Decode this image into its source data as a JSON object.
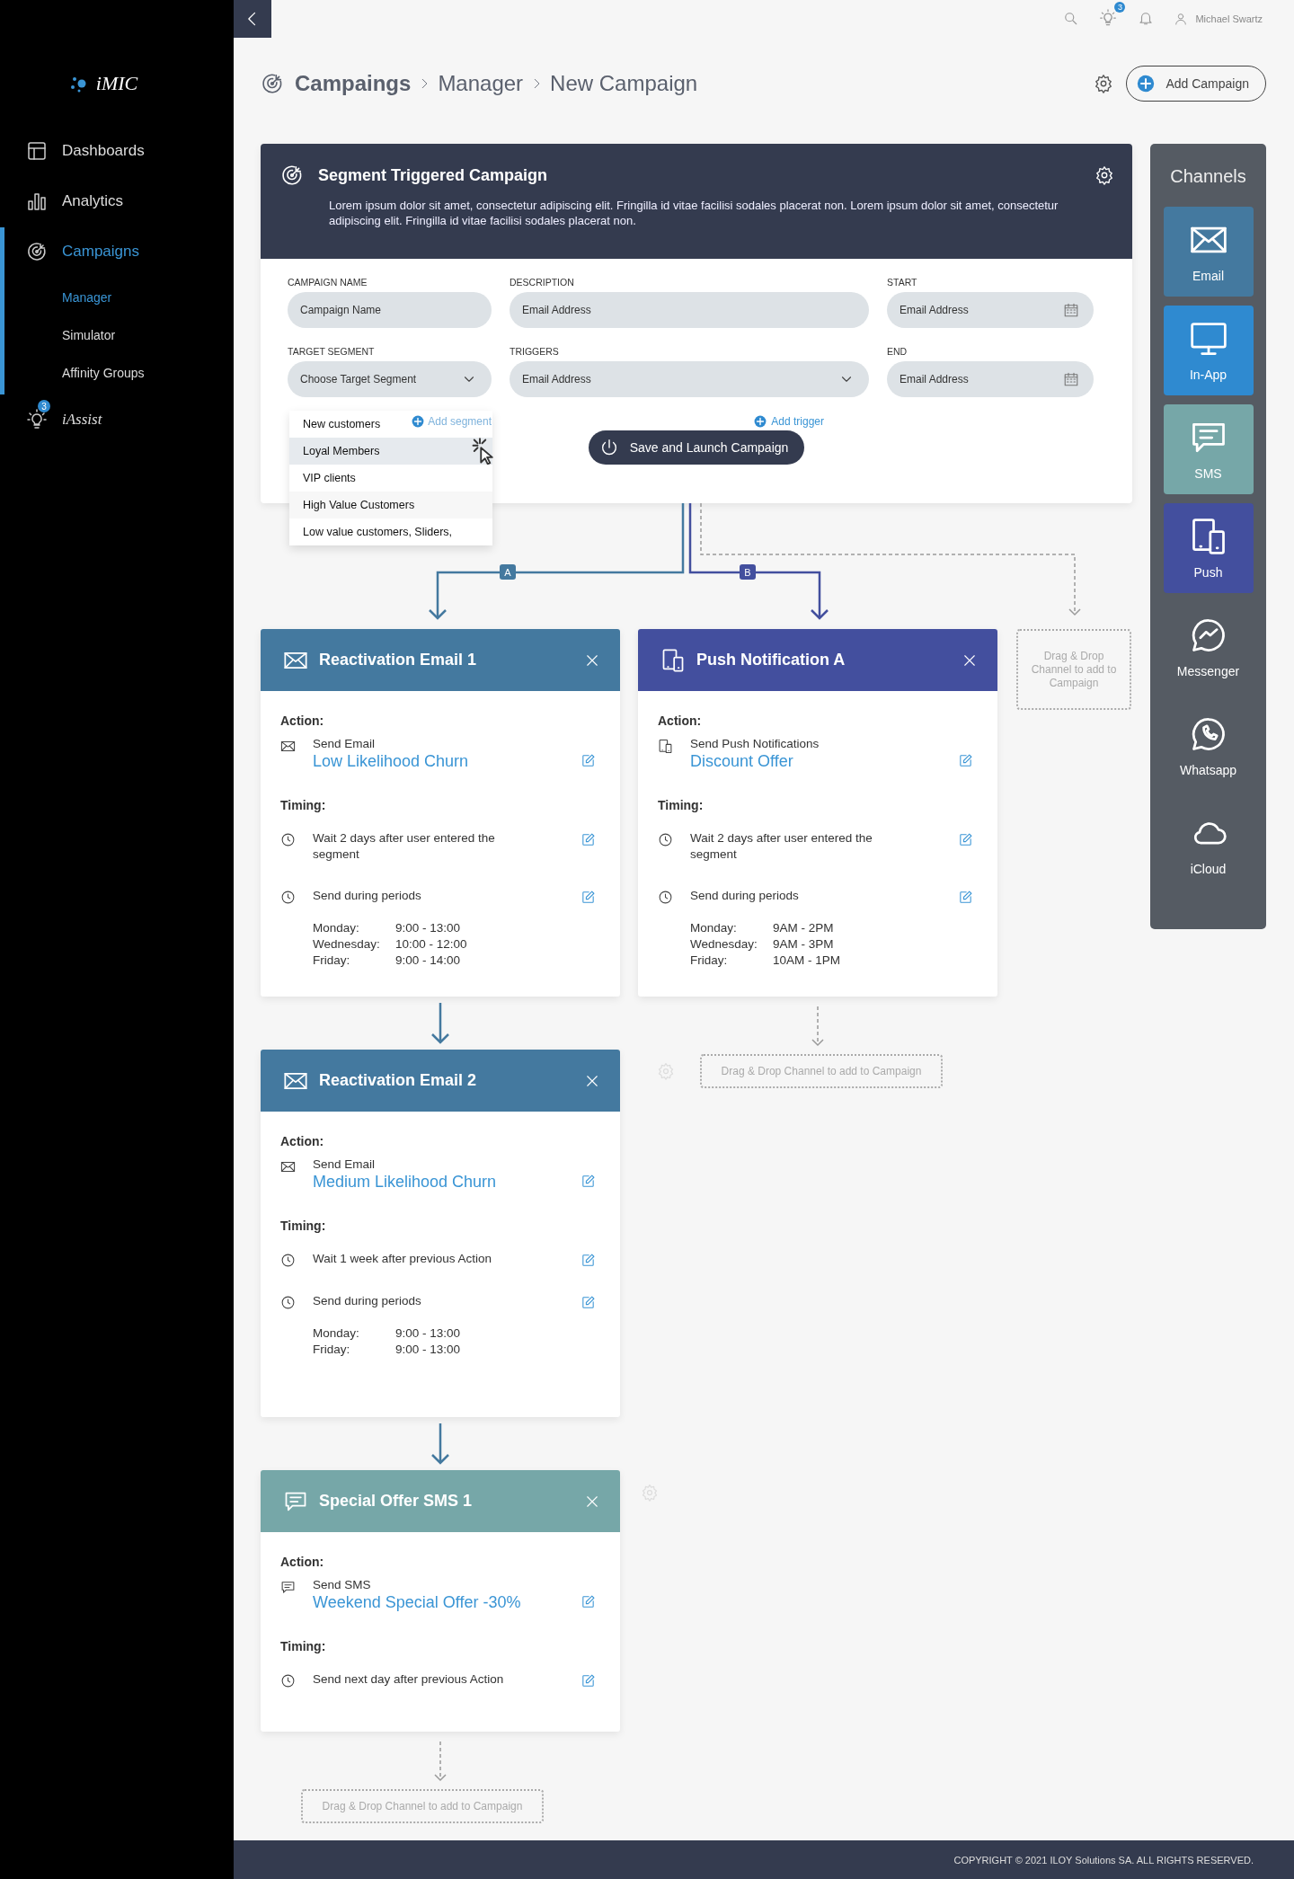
{
  "sidebar": {
    "logo": "iMIC",
    "items": [
      {
        "label": "Dashboards",
        "kind": "dashboard",
        "selected": false
      },
      {
        "label": "Analytics",
        "kind": "bars",
        "selected": false
      },
      {
        "label": "Campaigns",
        "kind": "target",
        "selected": true,
        "children": [
          {
            "label": "Manager",
            "selected": true
          },
          {
            "label": "Simulator",
            "selected": false
          },
          {
            "label": "Affinity Groups",
            "selected": false
          }
        ]
      },
      {
        "label": "iAssist",
        "kind": "bulb",
        "selected": false,
        "badge": "3"
      }
    ]
  },
  "topbar": {
    "hint_badge": "3",
    "user": "Michael Swartz"
  },
  "header": {
    "breadcrumb": [
      "Campaings",
      "Manager",
      "New Campaign"
    ],
    "add_button": "Add Campaign"
  },
  "campaign_panel": {
    "title": "Segment Triggered Campaign",
    "description": "Lorem ipsum dolor sit amet, consectetur adipiscing elit. Fringilla id vitae facilisi sodales  placerat non. Lorem ipsum dolor sit amet, consectetur adipiscing elit. Fringilla id vitae facilisi sodales  placerat non.",
    "fields": [
      {
        "label": "CAMPAIGN NAME",
        "placeholder": "Campaign Name",
        "kind": "text"
      },
      {
        "label": "DESCRIPTION",
        "placeholder": "Email Address",
        "kind": "text"
      },
      {
        "label": "START",
        "placeholder": "Email Address",
        "kind": "date"
      },
      {
        "label": "TARGET SEGMENT",
        "placeholder": "Choose Target Segment",
        "kind": "select"
      },
      {
        "label": "TRIGGERS",
        "placeholder": "Email Address",
        "kind": "select"
      },
      {
        "label": "END",
        "placeholder": "Email Address",
        "kind": "date"
      }
    ],
    "segment_options": [
      {
        "label": "New customers",
        "selected": false
      },
      {
        "label": "Loyal Members",
        "selected": true
      },
      {
        "label": "VIP clients",
        "selected": false
      },
      {
        "label": "High Value Customers",
        "selected": false
      },
      {
        "label": "Low value customers, Sliders,",
        "selected": false
      }
    ],
    "add_segment": "Add segment",
    "add_trigger": "Add trigger",
    "save_button": "Save and Launch Campaign"
  },
  "flow": {
    "branches": [
      {
        "label": "A",
        "color": "#44799f"
      },
      {
        "label": "B",
        "color": "#434f9e"
      }
    ],
    "columns": [
      {
        "cards": [
          {
            "kind": "email",
            "title": "Reactivation Email 1",
            "action_label": "Action:",
            "action_text": "Send Email",
            "action_link": "Low Likelihood Churn",
            "timing_label": "Timing:",
            "timings": [
              {
                "kind": "wait",
                "text": "Wait 2 days after user entered the segment"
              },
              {
                "kind": "periods",
                "text": "Send during periods",
                "periods": [
                  {
                    "day": "Monday:",
                    "time": "9:00 - 13:00"
                  },
                  {
                    "day": "Wednesday:",
                    "time": "10:00 - 12:00"
                  },
                  {
                    "day": "Friday:",
                    "time": "9:00 - 14:00"
                  }
                ]
              }
            ]
          },
          {
            "kind": "email",
            "title": "Reactivation Email 2",
            "action_label": "Action:",
            "action_text": "Send Email",
            "action_link": "Medium Likelihood Churn",
            "timing_label": "Timing:",
            "timings": [
              {
                "kind": "wait",
                "text": "Wait 1 week after previous Action"
              },
              {
                "kind": "periods",
                "text": "Send during periods",
                "periods": [
                  {
                    "day": "Monday:",
                    "time": "9:00 - 13:00"
                  },
                  {
                    "day": "Friday:",
                    "time": "9:00 - 13:00"
                  }
                ]
              }
            ]
          },
          {
            "kind": "sms",
            "title": "Special Offer SMS 1",
            "action_label": "Action:",
            "action_text": "Send SMS",
            "action_link": "Weekend Special Offer -30%",
            "timing_label": "Timing:",
            "timings": [
              {
                "kind": "wait",
                "text": "Send next day after previous Action"
              }
            ]
          }
        ],
        "drop_zone": "Drag & Drop Channel to add to Campaign"
      },
      {
        "cards": [
          {
            "kind": "push",
            "title": "Push Notification A",
            "action_label": "Action:",
            "action_text": "Send Push Notifications",
            "action_link": "Discount Offer",
            "timing_label": "Timing:",
            "timings": [
              {
                "kind": "wait",
                "text": "Wait 2 days after user entered the segment"
              },
              {
                "kind": "periods",
                "text": "Send during periods",
                "periods": [
                  {
                    "day": "Monday:",
                    "time": "9AM - 2PM"
                  },
                  {
                    "day": "Wednesday:",
                    "time": "9AM - 3PM"
                  },
                  {
                    "day": "Friday:",
                    "time": "10AM - 1PM"
                  }
                ]
              }
            ]
          }
        ],
        "drop_zone": "Drag & Drop Channel to add to Campaign"
      }
    ],
    "side_drop_zone": "Drag & Drop Channel to add to Campaign"
  },
  "channels": {
    "title": "Channels",
    "items": [
      {
        "label": "Email",
        "kind": "email",
        "color": "#44799f"
      },
      {
        "label": "In-App",
        "kind": "monitor",
        "color": "#2f8ad0"
      },
      {
        "label": "SMS",
        "kind": "chat",
        "color": "#76a7a8"
      },
      {
        "label": "Push",
        "kind": "devices",
        "color": "#434f9e"
      },
      {
        "label": "Messenger",
        "kind": "messenger"
      },
      {
        "label": "Whatsapp",
        "kind": "phonechat"
      },
      {
        "label": "iCloud",
        "kind": "cloud"
      }
    ]
  },
  "footer": {
    "copyright": "COPYRIGHT © 2021 ILOY Solutions SA. ALL RIGHTS RESERVED."
  }
}
